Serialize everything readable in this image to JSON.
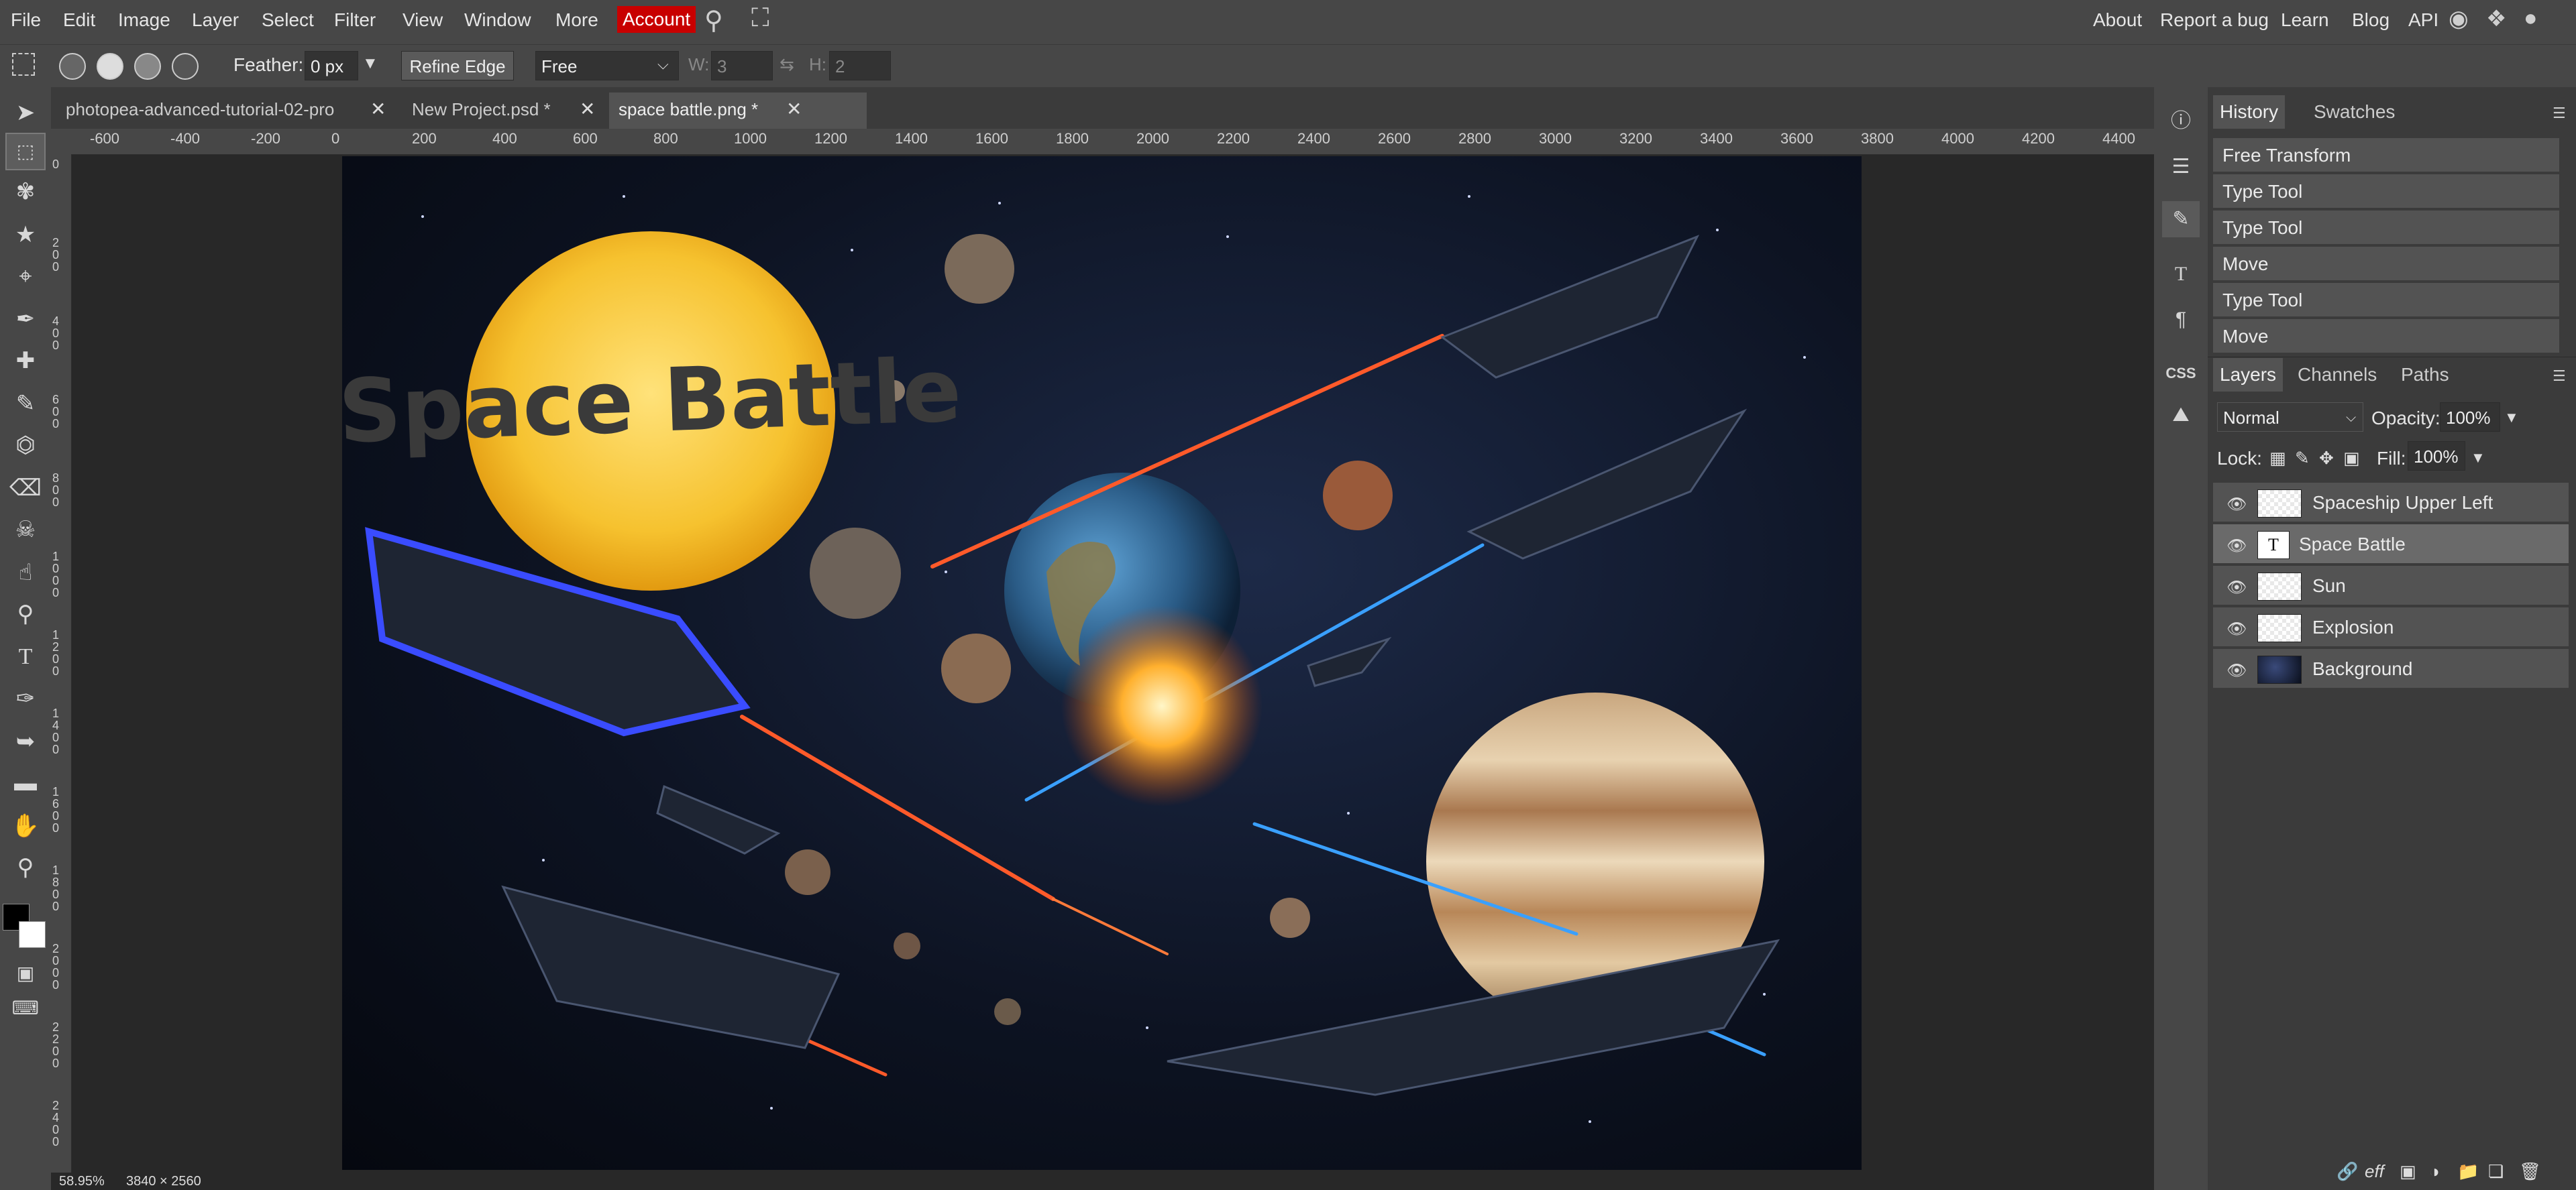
{
  "menu": {
    "items": [
      "File",
      "Edit",
      "Image",
      "Layer",
      "Select",
      "Filter",
      "View",
      "Window",
      "More"
    ],
    "account": "Account",
    "right_links": [
      "About",
      "Report a bug",
      "Learn",
      "Blog",
      "API"
    ]
  },
  "options": {
    "feather_label": "Feather:",
    "feather_value": "0 px",
    "refine_edge": "Refine Edge",
    "style_value": "Free",
    "w_label": "W:",
    "w_value": "3",
    "h_label": "H:",
    "h_value": "2"
  },
  "tabs": [
    {
      "label": "photopea-advanced-tutorial-02-pro",
      "active": false
    },
    {
      "label": "New Project.psd *",
      "active": false
    },
    {
      "label": "space battle.png *",
      "active": true
    }
  ],
  "ruler": {
    "h_labels": [
      "-600",
      "-400",
      "-200",
      "0",
      "200",
      "400",
      "600",
      "800",
      "1000",
      "1200",
      "1400",
      "1600",
      "1800",
      "2000",
      "2200",
      "2400",
      "2600",
      "2800",
      "3000",
      "3200",
      "3400",
      "3600",
      "3800",
      "4000",
      "4200",
      "4400"
    ],
    "v_labels": [
      "0",
      "200",
      "400",
      "600",
      "800",
      "1000",
      "1200",
      "1400",
      "1600",
      "1800",
      "2000",
      "2200",
      "2400"
    ]
  },
  "artwork": {
    "title_text": "Space Battle"
  },
  "status": {
    "zoom": "58.95%",
    "size": "3840 × 2560"
  },
  "history": {
    "tabs": [
      "History",
      "Swatches"
    ],
    "items": [
      "Free Transform",
      "Type Tool",
      "Type Tool",
      "Move",
      "Type Tool",
      "Move"
    ]
  },
  "layers": {
    "tabs": [
      "Layers",
      "Channels",
      "Paths"
    ],
    "blend_mode": "Normal",
    "opacity_label": "Opacity:",
    "opacity_value": "100%",
    "lock_label": "Lock:",
    "fill_label": "Fill:",
    "fill_value": "100%",
    "items": [
      {
        "name": "Spaceship Upper Left",
        "selected": false
      },
      {
        "name": "Space Battle",
        "selected": true
      },
      {
        "name": "Sun",
        "selected": false
      },
      {
        "name": "Explosion",
        "selected": false
      },
      {
        "name": "Background",
        "selected": false
      }
    ]
  },
  "colors": {
    "accent": "#c80000",
    "foreground": "#000000",
    "background": "#ffffff"
  }
}
